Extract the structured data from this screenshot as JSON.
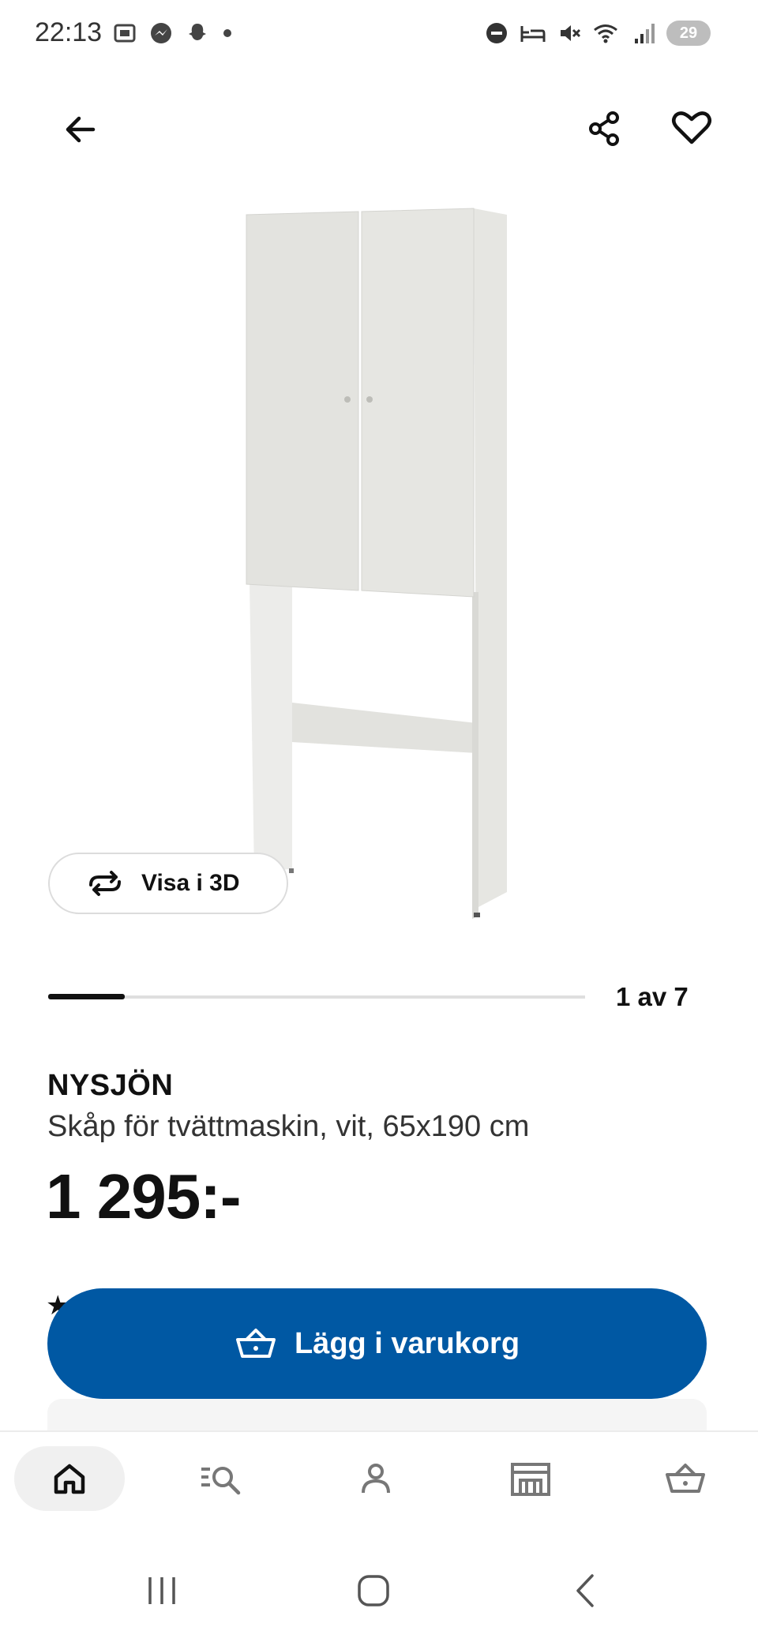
{
  "status_bar": {
    "time": "22:13",
    "battery": "29",
    "icons_left": [
      "screenshot-icon",
      "messenger-icon",
      "snapchat-icon",
      "dot-icon"
    ],
    "icons_right": [
      "dnd-icon",
      "sleep-icon",
      "mute-icon",
      "wifi-icon",
      "signal-icon",
      "battery-icon"
    ]
  },
  "top_bar": {
    "back_icon": "arrow-left-icon",
    "share_icon": "share-icon",
    "favorite_icon": "heart-icon"
  },
  "gallery": {
    "view_3d_label": "Visa i 3D",
    "counter": "1 av 7",
    "current": 1,
    "total": 7
  },
  "product": {
    "name": "NYSJÖN",
    "description": "Skåp för tvättmaskin, vit, 65x190 cm",
    "price": "1 295:-"
  },
  "actions": {
    "add_to_cart_label": "Lägg i varukorg",
    "accent_color": "#0058a3"
  },
  "bottom_nav": {
    "items": [
      {
        "name": "home",
        "icon": "home-icon",
        "active": true
      },
      {
        "name": "search",
        "icon": "search-list-icon",
        "active": false
      },
      {
        "name": "profile",
        "icon": "user-icon",
        "active": false
      },
      {
        "name": "store",
        "icon": "store-icon",
        "active": false
      },
      {
        "name": "cart",
        "icon": "basket-icon",
        "active": false
      }
    ]
  }
}
